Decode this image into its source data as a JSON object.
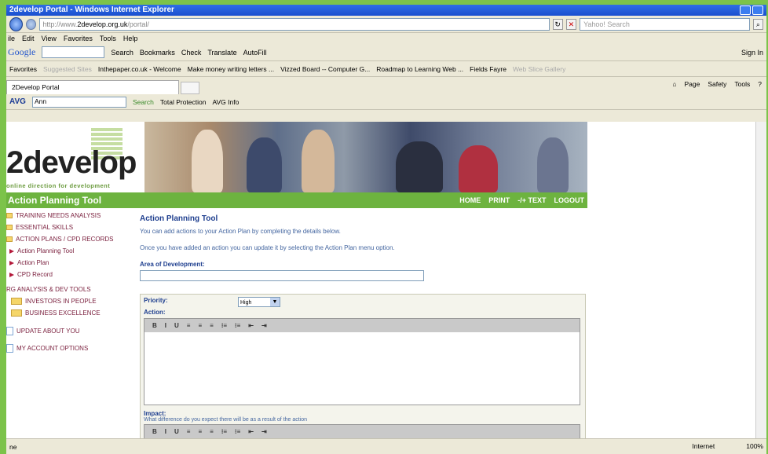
{
  "window": {
    "title": "2develop Portal - Windows Internet Explorer"
  },
  "address": {
    "url_prefix": "http://www.",
    "url_domain": "2develop.org.uk",
    "url_path": "/portal/",
    "search_placeholder": "Yahoo! Search"
  },
  "menu": [
    "ile",
    "Edit",
    "View",
    "Favorites",
    "Tools",
    "Help"
  ],
  "google_bar": {
    "brand": "Google",
    "items": [
      "Search",
      "Bookmarks",
      "Check",
      "Translate",
      "AutoFill"
    ],
    "signin": "Sign In"
  },
  "favorites_bar": {
    "label": "Favorites",
    "items": [
      "Suggested Sites",
      "Inthepaper.co.uk - Welcome",
      "Make money writing letters ...",
      "Vizzed Board -- Computer G...",
      "Roadmap to Learning Web ...",
      "Fields Fayre",
      "Web Slice Gallery"
    ]
  },
  "tab": {
    "label": "2Develop Portal",
    "tools": [
      "Page",
      "Safety",
      "Tools"
    ]
  },
  "avg_bar": {
    "brand": "AVG",
    "field": "Ann",
    "search": "Search",
    "protection": "Total Protection",
    "info": "AVG Info"
  },
  "site": {
    "logo": "2develop",
    "tagline": "online direction for development",
    "bar_title": "Action Planning Tool",
    "top_links": [
      "HOME",
      "PRINT",
      "-/+ TEXT",
      "LOGOUT"
    ],
    "sidebar": [
      {
        "label": "TRAINING NEEDS ANALYSIS",
        "kind": "top"
      },
      {
        "label": "ESSENTIAL SKILLS",
        "kind": "top"
      },
      {
        "label": "ACTION PLANS / CPD RECORDS",
        "kind": "top"
      },
      {
        "label": "Action Planning Tool",
        "kind": "sub"
      },
      {
        "label": "Action Plan",
        "kind": "sub"
      },
      {
        "label": "CPD Record",
        "kind": "sub"
      },
      {
        "label": "RG ANALYSIS & DEV TOOLS",
        "kind": "grp"
      },
      {
        "label": "INVESTORS IN PEOPLE",
        "kind": "folder"
      },
      {
        "label": "BUSINESS EXCELLENCE",
        "kind": "folder"
      },
      {
        "label": "UPDATE ABOUT YOU",
        "kind": "page"
      },
      {
        "label": "MY ACCOUNT OPTIONS",
        "kind": "page"
      }
    ],
    "main": {
      "title": "Action Planning Tool",
      "intro1": "You can add actions to your Action Plan by completing the details below.",
      "intro2": "Once you have added an action you can update it by selecting the Action Plan menu option.",
      "area_label": "Area of Development:",
      "priority_label": "Priority:",
      "priority_value": "High",
      "action_label": "Action:",
      "impact_label": "Impact:",
      "impact_sub": "What difference do you expect there will be as a result of the action",
      "toolbar": [
        "B",
        "I",
        "U",
        "≡",
        "≡",
        "≡",
        "⁝≡",
        "⁝≡",
        "⇤",
        "⇥"
      ]
    }
  },
  "status": {
    "left": "ne",
    "zone": "Internet",
    "zoom": "100%"
  }
}
